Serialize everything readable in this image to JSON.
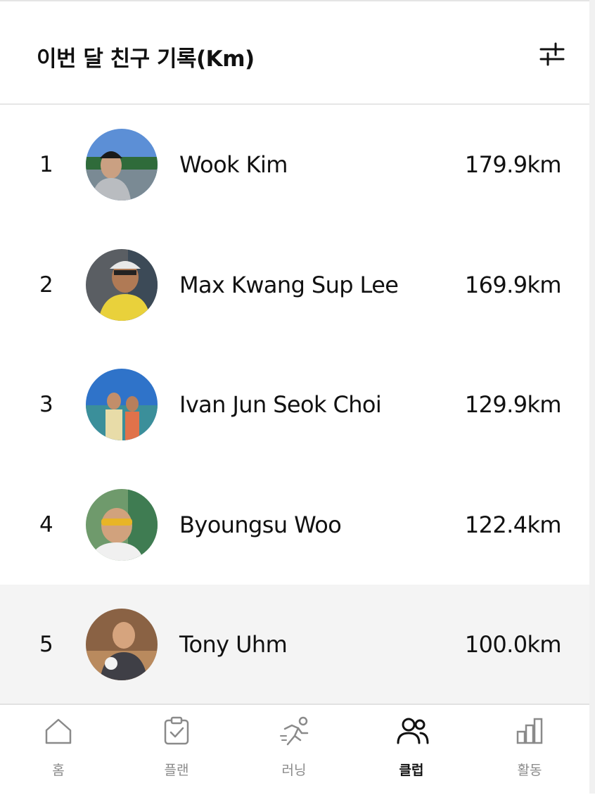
{
  "header": {
    "title": "이번 달 친구 기록(Km)",
    "filter_icon": "sliders-icon"
  },
  "leaderboard": [
    {
      "rank": "1",
      "name": "Wook Kim",
      "distance": "179.9km",
      "highlighted": false
    },
    {
      "rank": "2",
      "name": "Max Kwang Sup Lee",
      "distance": "169.9km",
      "highlighted": false
    },
    {
      "rank": "3",
      "name": "Ivan Jun Seok Choi",
      "distance": "129.9km",
      "highlighted": false
    },
    {
      "rank": "4",
      "name": "Byoungsu Woo",
      "distance": "122.4km",
      "highlighted": false
    },
    {
      "rank": "5",
      "name": "Tony Uhm",
      "distance": "100.0km",
      "highlighted": true
    }
  ],
  "tabbar": {
    "active": "club",
    "tabs": [
      {
        "id": "home",
        "label": "홈",
        "icon": "home-icon"
      },
      {
        "id": "plan",
        "label": "플랜",
        "icon": "clipboard-check-icon"
      },
      {
        "id": "running",
        "label": "러닝",
        "icon": "runner-icon"
      },
      {
        "id": "club",
        "label": "클럽",
        "icon": "users-icon"
      },
      {
        "id": "activity",
        "label": "활동",
        "icon": "bar-chart-icon"
      }
    ]
  },
  "colors": {
    "active": "#111111",
    "inactive": "#8a8a8a",
    "highlight_row": "#f4f4f4",
    "divider": "#e6e6e6"
  }
}
